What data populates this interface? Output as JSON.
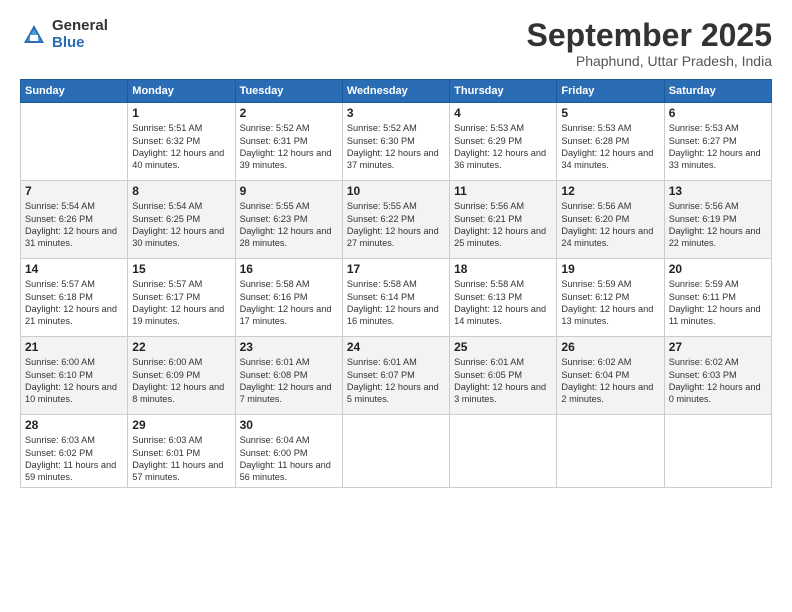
{
  "logo": {
    "general": "General",
    "blue": "Blue"
  },
  "title": "September 2025",
  "subtitle": "Phaphund, Uttar Pradesh, India",
  "weekdays": [
    "Sunday",
    "Monday",
    "Tuesday",
    "Wednesday",
    "Thursday",
    "Friday",
    "Saturday"
  ],
  "weeks": [
    [
      {
        "day": null
      },
      {
        "day": "1",
        "sunrise": "5:51 AM",
        "sunset": "6:32 PM",
        "daylight": "12 hours and 40 minutes."
      },
      {
        "day": "2",
        "sunrise": "5:52 AM",
        "sunset": "6:31 PM",
        "daylight": "12 hours and 39 minutes."
      },
      {
        "day": "3",
        "sunrise": "5:52 AM",
        "sunset": "6:30 PM",
        "daylight": "12 hours and 37 minutes."
      },
      {
        "day": "4",
        "sunrise": "5:53 AM",
        "sunset": "6:29 PM",
        "daylight": "12 hours and 36 minutes."
      },
      {
        "day": "5",
        "sunrise": "5:53 AM",
        "sunset": "6:28 PM",
        "daylight": "12 hours and 34 minutes."
      },
      {
        "day": "6",
        "sunrise": "5:53 AM",
        "sunset": "6:27 PM",
        "daylight": "12 hours and 33 minutes."
      }
    ],
    [
      {
        "day": "7",
        "sunrise": "5:54 AM",
        "sunset": "6:26 PM",
        "daylight": "12 hours and 31 minutes."
      },
      {
        "day": "8",
        "sunrise": "5:54 AM",
        "sunset": "6:25 PM",
        "daylight": "12 hours and 30 minutes."
      },
      {
        "day": "9",
        "sunrise": "5:55 AM",
        "sunset": "6:23 PM",
        "daylight": "12 hours and 28 minutes."
      },
      {
        "day": "10",
        "sunrise": "5:55 AM",
        "sunset": "6:22 PM",
        "daylight": "12 hours and 27 minutes."
      },
      {
        "day": "11",
        "sunrise": "5:56 AM",
        "sunset": "6:21 PM",
        "daylight": "12 hours and 25 minutes."
      },
      {
        "day": "12",
        "sunrise": "5:56 AM",
        "sunset": "6:20 PM",
        "daylight": "12 hours and 24 minutes."
      },
      {
        "day": "13",
        "sunrise": "5:56 AM",
        "sunset": "6:19 PM",
        "daylight": "12 hours and 22 minutes."
      }
    ],
    [
      {
        "day": "14",
        "sunrise": "5:57 AM",
        "sunset": "6:18 PM",
        "daylight": "12 hours and 21 minutes."
      },
      {
        "day": "15",
        "sunrise": "5:57 AM",
        "sunset": "6:17 PM",
        "daylight": "12 hours and 19 minutes."
      },
      {
        "day": "16",
        "sunrise": "5:58 AM",
        "sunset": "6:16 PM",
        "daylight": "12 hours and 17 minutes."
      },
      {
        "day": "17",
        "sunrise": "5:58 AM",
        "sunset": "6:14 PM",
        "daylight": "12 hours and 16 minutes."
      },
      {
        "day": "18",
        "sunrise": "5:58 AM",
        "sunset": "6:13 PM",
        "daylight": "12 hours and 14 minutes."
      },
      {
        "day": "19",
        "sunrise": "5:59 AM",
        "sunset": "6:12 PM",
        "daylight": "12 hours and 13 minutes."
      },
      {
        "day": "20",
        "sunrise": "5:59 AM",
        "sunset": "6:11 PM",
        "daylight": "12 hours and 11 minutes."
      }
    ],
    [
      {
        "day": "21",
        "sunrise": "6:00 AM",
        "sunset": "6:10 PM",
        "daylight": "12 hours and 10 minutes."
      },
      {
        "day": "22",
        "sunrise": "6:00 AM",
        "sunset": "6:09 PM",
        "daylight": "12 hours and 8 minutes."
      },
      {
        "day": "23",
        "sunrise": "6:01 AM",
        "sunset": "6:08 PM",
        "daylight": "12 hours and 7 minutes."
      },
      {
        "day": "24",
        "sunrise": "6:01 AM",
        "sunset": "6:07 PM",
        "daylight": "12 hours and 5 minutes."
      },
      {
        "day": "25",
        "sunrise": "6:01 AM",
        "sunset": "6:05 PM",
        "daylight": "12 hours and 3 minutes."
      },
      {
        "day": "26",
        "sunrise": "6:02 AM",
        "sunset": "6:04 PM",
        "daylight": "12 hours and 2 minutes."
      },
      {
        "day": "27",
        "sunrise": "6:02 AM",
        "sunset": "6:03 PM",
        "daylight": "12 hours and 0 minutes."
      }
    ],
    [
      {
        "day": "28",
        "sunrise": "6:03 AM",
        "sunset": "6:02 PM",
        "daylight": "11 hours and 59 minutes."
      },
      {
        "day": "29",
        "sunrise": "6:03 AM",
        "sunset": "6:01 PM",
        "daylight": "11 hours and 57 minutes."
      },
      {
        "day": "30",
        "sunrise": "6:04 AM",
        "sunset": "6:00 PM",
        "daylight": "11 hours and 56 minutes."
      },
      {
        "day": null
      },
      {
        "day": null
      },
      {
        "day": null
      },
      {
        "day": null
      }
    ]
  ]
}
